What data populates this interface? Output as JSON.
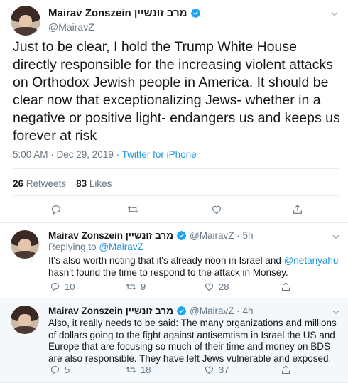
{
  "main_tweet": {
    "author_name": "Mairav Zonszein מרב זונשיין",
    "handle": "@MairavZ",
    "text": "Just to be clear, I hold the Trump White House directly responsible for the increasing violent attacks on Orthodox Jewish people in America. It should be clear now that exceptionalizing Jews- whether in a negative or positive light- endangers us and keeps us forever at risk",
    "time": "5:00 AM · Dec 29, 2019",
    "source": "Twitter for iPhone",
    "retweets_count": "26",
    "retweets_label": "Retweets",
    "likes_count": "83",
    "likes_label": "Likes"
  },
  "replies": [
    {
      "author_name": "Mairav Zonszein מרב זונשיין",
      "handle_time": "@MairavZ · 5h",
      "replying_prefix": "Replying to",
      "replying_handle": "@MairavZ",
      "text_before": "It's also worth noting that it's already noon in Israel and ",
      "mention": "@netanyahu",
      "text_after": " hasn't found the time to respond to the attack in Monsey.",
      "reply_count": "10",
      "retweet_count": "9",
      "like_count": "28"
    },
    {
      "author_name": "Mairav Zonszein מרב זונשיין",
      "handle_time": "@MairavZ · 4h",
      "text": "Also, it really needs to be said: The many organizations and millions of dollars going to the fight against antisemtism in Israel the US and Europe that are focusing so much of their time and money on BDS are also responsible. They have left Jews vulnerable and exposed.",
      "reply_count": "5",
      "retweet_count": "18",
      "like_count": "37"
    }
  ],
  "colors": {
    "link": "#1b95e0",
    "muted": "#657786",
    "verified": "#1da1f2",
    "highlight_bg": "#f5f8fa"
  }
}
